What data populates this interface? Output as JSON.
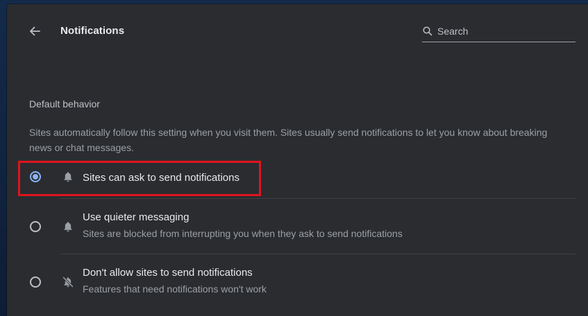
{
  "header": {
    "title": "Notifications",
    "back_icon": "arrow-left-icon",
    "search": {
      "placeholder": "Search",
      "value": "",
      "icon": "search-icon"
    }
  },
  "section": {
    "title": "Default behavior",
    "description": "Sites automatically follow this setting when you visit them. Sites usually send notifications to let you know about breaking news or chat messages."
  },
  "options": [
    {
      "label": "Sites can ask to send notifications",
      "sublabel": "",
      "icon": "bell-icon",
      "selected": true
    },
    {
      "label": "Use quieter messaging",
      "sublabel": "Sites are blocked from interrupting you when they ask to send notifications",
      "icon": "bell-icon",
      "selected": false
    },
    {
      "label": "Don't allow sites to send notifications",
      "sublabel": "Features that need notifications won't work",
      "icon": "bell-off-icon",
      "selected": false
    }
  ],
  "colors": {
    "panel_bg": "#2b2c30",
    "accent": "#8ab4f8",
    "highlight": "#e0141e",
    "text_primary": "#e8eaed",
    "text_secondary": "#9aa0a6"
  }
}
